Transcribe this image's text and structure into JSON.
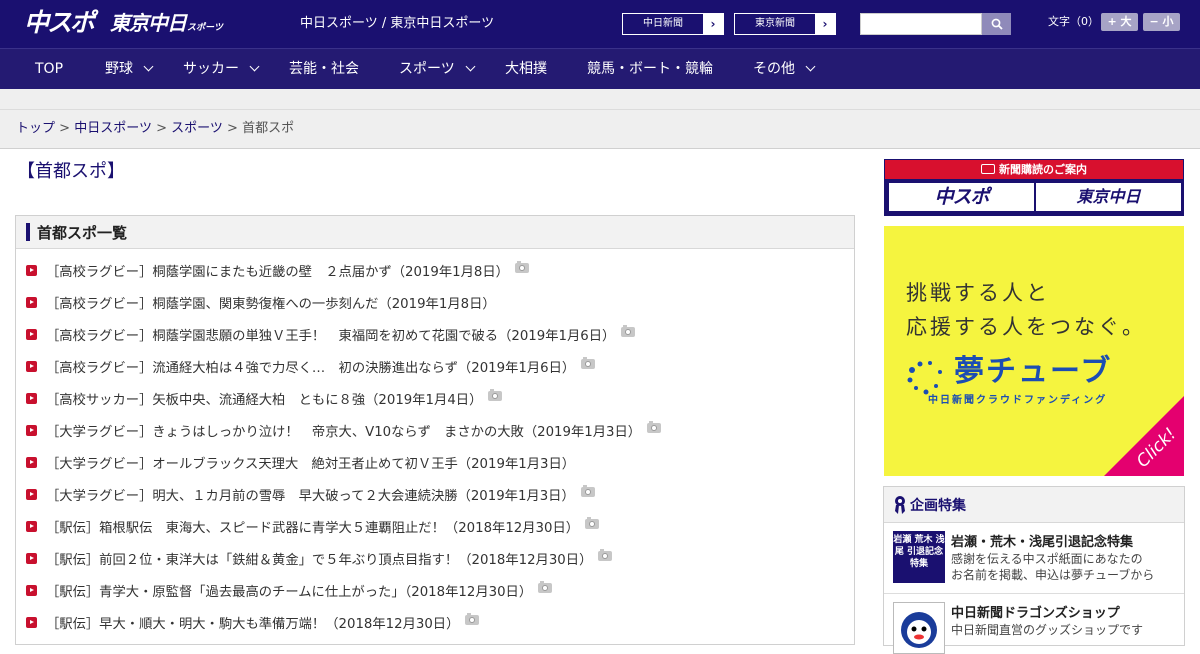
{
  "header": {
    "logo_chuspo": "中スポ",
    "logo_tokyo": "東京中日",
    "logo_tokyo_small": "スポーツ",
    "site_title": "中日スポーツ / 東京中日スポーツ",
    "paper_buttons": [
      "中日新聞",
      "東京新聞"
    ],
    "search": {
      "placeholder": "",
      "value": ""
    },
    "font_size": {
      "label": "文字（0）",
      "increase": "+ 大",
      "decrease": "− 小"
    }
  },
  "nav": {
    "items": [
      {
        "label": "TOP",
        "dropdown": false
      },
      {
        "label": "野球",
        "dropdown": true
      },
      {
        "label": "サッカー",
        "dropdown": true
      },
      {
        "label": "芸能・社会",
        "dropdown": false
      },
      {
        "label": "スポーツ",
        "dropdown": true
      },
      {
        "label": "大相撲",
        "dropdown": false
      },
      {
        "label": "競馬・ボート・競輪",
        "dropdown": false
      },
      {
        "label": "その他",
        "dropdown": true
      }
    ]
  },
  "breadcrumb": {
    "items": [
      "トップ",
      "中日スポーツ",
      "スポーツ"
    ],
    "current": "首都スポ",
    "separator": ">"
  },
  "page_title": "【首都スポ】",
  "list": {
    "heading": "首都スポ一覧",
    "articles": [
      {
        "text": "［高校ラグビー］桐蔭学園にまたも近畿の壁　２点届かず（2019年1月8日）",
        "photo": true
      },
      {
        "text": "［高校ラグビー］桐蔭学園、関東勢復権への一歩刻んだ（2019年1月8日）",
        "photo": false
      },
      {
        "text": "［高校ラグビー］桐蔭学園悲願の単独Ｖ王手！　東福岡を初めて花園で破る（2019年1月6日）",
        "photo": true
      },
      {
        "text": "［高校ラグビー］流通経大柏は４強で力尽く…　初の決勝進出ならず（2019年1月6日）",
        "photo": true
      },
      {
        "text": "［高校サッカー］矢板中央、流通経大柏　ともに８強（2019年1月4日）",
        "photo": true
      },
      {
        "text": "［大学ラグビー］きょうはしっかり泣け！　帝京大、V10ならず　まさかの大敗（2019年1月3日）",
        "photo": true
      },
      {
        "text": "［大学ラグビー］オールブラックス天理大　絶対王者止めて初Ｖ王手（2019年1月3日）",
        "photo": false
      },
      {
        "text": "［大学ラグビー］明大、１カ月前の雪辱　早大破って２大会連続決勝（2019年1月3日）",
        "photo": true
      },
      {
        "text": "［駅伝］箱根駅伝　東海大、スピード武器に青学大５連覇阻止だ！（2018年12月30日）",
        "photo": true
      },
      {
        "text": "［駅伝］前回２位・東洋大は「鉄紺＆黄金」で５年ぶり頂点目指す！（2018年12月30日）",
        "photo": true
      },
      {
        "text": "［駅伝］青学大・原監督「過去最高のチームに仕上がった」（2018年12月30日）",
        "photo": true
      },
      {
        "text": "［駅伝］早大・順大・明大・駒大も準備万端！（2018年12月30日）",
        "photo": true
      }
    ]
  },
  "sidebar": {
    "subscribe": {
      "header": "新聞購読のご案内",
      "logos": [
        "中スポ",
        "東京中日"
      ]
    },
    "ad": {
      "line1": "挑戦する人と",
      "line2": "応援する人をつなぐ。",
      "brand": "夢チューブ",
      "sub": "中日新聞クラウドファンディング",
      "click": "Click!",
      "colors": {
        "background": "#f5f43f",
        "brand": "#1b4db3",
        "corner": "#e4006f"
      }
    },
    "features": {
      "heading": "企画特集",
      "items": [
        {
          "thumb": "岩瀬 荒木 浅尾 引退記念 特集",
          "title": "岩瀬・荒木・浅尾引退記念特集",
          "desc1": "感謝を伝える中スポ紙面にあなたの",
          "desc2": "お名前を掲載、申込は夢チューブから"
        },
        {
          "thumb": "",
          "title": "中日新聞ドラゴンズショップ",
          "desc1": "中日新聞直営のグッズショップです",
          "desc2": ""
        }
      ]
    }
  },
  "colors": {
    "primary": "#1a1070",
    "nav": "#241a72",
    "accent_red": "#c8102e"
  }
}
